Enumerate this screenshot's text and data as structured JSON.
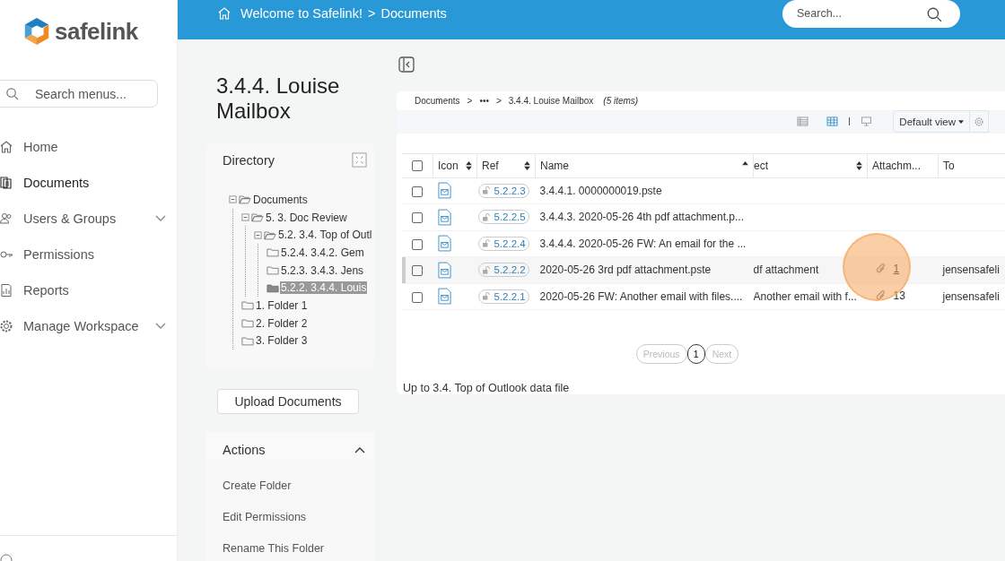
{
  "sidebar": {
    "brand": "safelink",
    "search": {
      "placeholder": "Search menus..."
    },
    "items": [
      {
        "label": "Home",
        "kind": "home",
        "selected": false,
        "expandable": false
      },
      {
        "label": "Documents",
        "kind": "documents",
        "selected": true,
        "expandable": false
      },
      {
        "label": "Users & Groups",
        "kind": "users",
        "selected": false,
        "expandable": true
      },
      {
        "label": "Permissions",
        "kind": "key",
        "selected": false,
        "expandable": false
      },
      {
        "label": "Reports",
        "kind": "report",
        "selected": false,
        "expandable": false
      },
      {
        "label": "Manage Workspace",
        "kind": "gear",
        "selected": false,
        "expandable": true
      }
    ]
  },
  "topbar": {
    "breadcrumb": [
      "Welcome to Safelink!",
      "Documents"
    ],
    "separator": ">",
    "search": {
      "placeholder": "Search..."
    }
  },
  "page_title": "3.4.4. Louise Mailbox",
  "directory": {
    "title": "Directory",
    "tree": [
      {
        "label": "Documents",
        "expanded": true,
        "selected": false,
        "children": [
          {
            "label": "5. 3. Doc Review",
            "expanded": true,
            "selected": false,
            "children": [
              {
                "label": "5.2. 3.4. Top of Outl",
                "expanded": true,
                "selected": false,
                "children": [
                  {
                    "label": "5.2.4. 3.4.2. Gem",
                    "selected": false
                  },
                  {
                    "label": "5.2.3. 3.4.3. Jens",
                    "selected": false
                  },
                  {
                    "label": "5.2.2. 3.4.4. Louis",
                    "selected": true
                  }
                ]
              }
            ]
          },
          {
            "label": "1. Folder 1",
            "selected": false
          },
          {
            "label": "2. Folder 2",
            "selected": false
          },
          {
            "label": "3. Folder 3",
            "selected": false
          }
        ]
      }
    ]
  },
  "upload_button": "Upload Documents",
  "actions": {
    "title": "Actions",
    "expanded": true,
    "items": [
      "Create Folder",
      "Edit Permissions",
      "Rename This Folder"
    ]
  },
  "breadcrumb": {
    "items": [
      "Documents",
      "•••",
      "3.4.4. Louise Mailbox"
    ],
    "separator": ">",
    "count": "(5 items)"
  },
  "toolbar": {
    "views": [
      {
        "kind": "list",
        "selected": false
      },
      {
        "kind": "grid",
        "selected": true
      },
      {
        "kind": "monitor",
        "selected": false
      }
    ],
    "view_select": "Default view"
  },
  "table": {
    "select_all_checked": false,
    "columns": [
      {
        "label": "Icon",
        "sortable": true,
        "sorted": false
      },
      {
        "label": "Ref",
        "sortable": true,
        "sorted": false
      },
      {
        "label": "Name",
        "sortable": true,
        "sorted": true
      },
      {
        "label": "ect",
        "sortable": true,
        "sorted": false
      },
      {
        "label": "Attachm..."
      },
      {
        "label": "To"
      }
    ],
    "rows": [
      {
        "ref": "5.2.2.3",
        "name": "3.4.4.1. 0000000019.pste",
        "subject": "",
        "attachments": "",
        "to": "",
        "selected": false,
        "checked": false
      },
      {
        "ref": "5.2.2.5",
        "name": "3.4.4.3. 2020-05-26 4th pdf attachment.p...",
        "subject": "",
        "attachments": "",
        "to": "",
        "selected": false,
        "checked": false
      },
      {
        "ref": "5.2.2.4",
        "name": "3.4.4.4. 2020-05-26 FW: An email for the ...",
        "subject": "",
        "attachments": "",
        "to": "",
        "selected": false,
        "checked": false
      },
      {
        "ref": "5.2.2.2",
        "name": "2020-05-26 3rd pdf attachment.pste",
        "subject": "df attachment",
        "attachments": "1",
        "to": "jensensafeli",
        "selected": true,
        "checked": false
      },
      {
        "ref": "5.2.2.1",
        "name": "2020-05-26 FW: Another email with files....",
        "subject": "Another email with f...",
        "attachments": "13",
        "to": "jensensafeli",
        "selected": false,
        "checked": false
      }
    ]
  },
  "pagination": [
    {
      "label": "Previous",
      "kind": "nav",
      "disabled": true
    },
    {
      "label": "1",
      "kind": "page",
      "selected": true
    },
    {
      "label": "Next",
      "kind": "nav",
      "disabled": true
    }
  ],
  "footer_link": "Up to 3.4. Top of Outlook data file"
}
